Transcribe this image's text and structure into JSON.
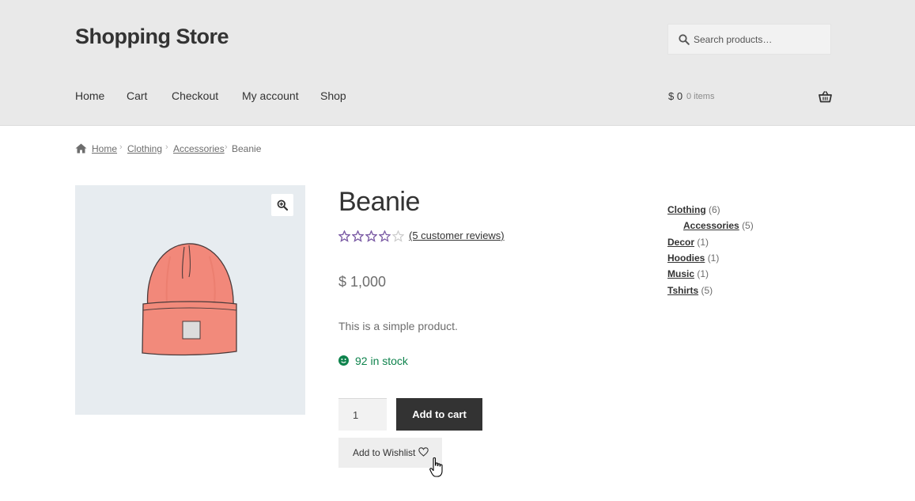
{
  "site": {
    "title": "Shopping Store"
  },
  "search": {
    "placeholder": "Search products…"
  },
  "nav": {
    "items": [
      "Home",
      "Cart",
      "Checkout",
      "My account",
      "Shop"
    ]
  },
  "cart": {
    "total": "$ 0",
    "count": "0 items"
  },
  "breadcrumb": {
    "items": [
      "Home",
      "Clothing",
      "Accessories"
    ],
    "current": "Beanie"
  },
  "product": {
    "title": "Beanie",
    "rating_stars": 3.5,
    "rating_max": 5,
    "review_link": "(5 customer reviews)",
    "price": "$ 1,000",
    "description": "This is a simple product.",
    "stock": "92 in stock",
    "quantity": "1",
    "add_to_cart_label": "Add to cart",
    "wishlist_label": "Add to Wishlist"
  },
  "categories": [
    {
      "name": "Clothing",
      "count": "(6)"
    },
    {
      "name": "Accessories",
      "count": "(5)"
    },
    {
      "name": "Decor",
      "count": "(1)"
    },
    {
      "name": "Hoodies",
      "count": "(1)"
    },
    {
      "name": "Music",
      "count": "(1)"
    },
    {
      "name": "Tshirts",
      "count": "(5)"
    }
  ],
  "colors": {
    "header_bg": "#e9e9e9",
    "star": "#7d5ea6",
    "stock": "#0f834d",
    "button_dark": "#333333"
  }
}
